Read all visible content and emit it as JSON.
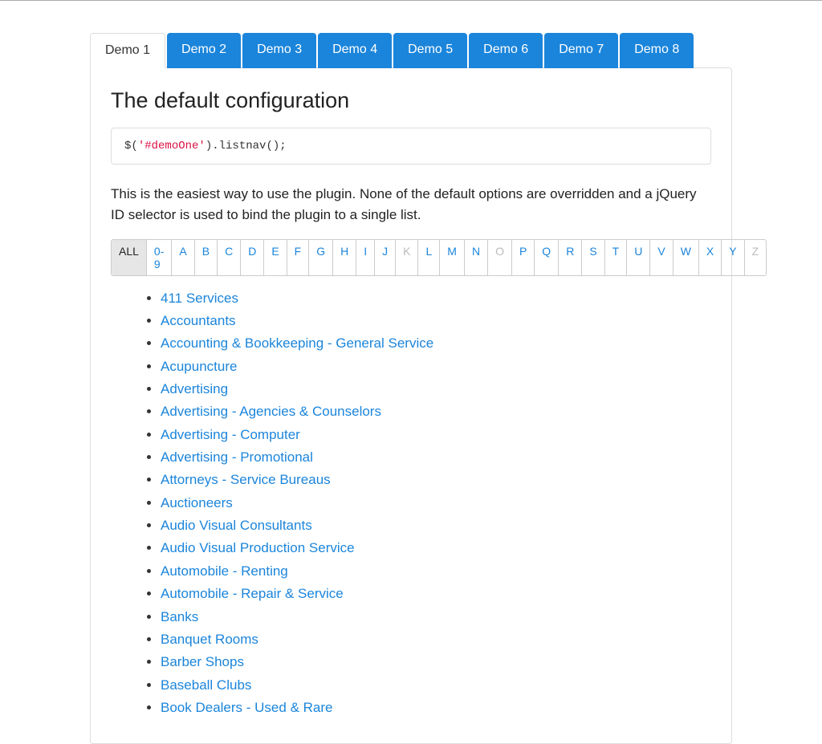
{
  "tabs": [
    {
      "label": "Demo 1",
      "active": true
    },
    {
      "label": "Demo 2",
      "active": false
    },
    {
      "label": "Demo 3",
      "active": false
    },
    {
      "label": "Demo 4",
      "active": false
    },
    {
      "label": "Demo 5",
      "active": false
    },
    {
      "label": "Demo 6",
      "active": false
    },
    {
      "label": "Demo 7",
      "active": false
    },
    {
      "label": "Demo 8",
      "active": false
    }
  ],
  "heading": "The default configuration",
  "code": {
    "prefix": "$(",
    "selector": "'#demoOne'",
    "suffix": ").listnav();"
  },
  "description": "This is the easiest way to use the plugin. None of the default options are overridden and a jQuery ID selector is used to bind the plugin to a single list.",
  "letters": [
    {
      "label": "ALL",
      "state": "selected"
    },
    {
      "label": "0-9",
      "state": "enabled"
    },
    {
      "label": "A",
      "state": "enabled"
    },
    {
      "label": "B",
      "state": "enabled"
    },
    {
      "label": "C",
      "state": "enabled"
    },
    {
      "label": "D",
      "state": "enabled"
    },
    {
      "label": "E",
      "state": "enabled"
    },
    {
      "label": "F",
      "state": "enabled"
    },
    {
      "label": "G",
      "state": "enabled"
    },
    {
      "label": "H",
      "state": "enabled"
    },
    {
      "label": "I",
      "state": "enabled"
    },
    {
      "label": "J",
      "state": "enabled"
    },
    {
      "label": "K",
      "state": "disabled"
    },
    {
      "label": "L",
      "state": "enabled"
    },
    {
      "label": "M",
      "state": "enabled"
    },
    {
      "label": "N",
      "state": "enabled"
    },
    {
      "label": "O",
      "state": "disabled"
    },
    {
      "label": "P",
      "state": "enabled"
    },
    {
      "label": "Q",
      "state": "enabled"
    },
    {
      "label": "R",
      "state": "enabled"
    },
    {
      "label": "S",
      "state": "enabled"
    },
    {
      "label": "T",
      "state": "enabled"
    },
    {
      "label": "U",
      "state": "enabled"
    },
    {
      "label": "V",
      "state": "enabled"
    },
    {
      "label": "W",
      "state": "enabled"
    },
    {
      "label": "X",
      "state": "enabled"
    },
    {
      "label": "Y",
      "state": "enabled"
    },
    {
      "label": "Z",
      "state": "disabled"
    }
  ],
  "items": [
    "411 Services",
    "Accountants",
    "Accounting & Bookkeeping - General Service",
    "Acupuncture",
    "Advertising",
    "Advertising - Agencies & Counselors",
    "Advertising - Computer",
    "Advertising - Promotional",
    "Attorneys - Service Bureaus",
    "Auctioneers",
    "Audio Visual Consultants",
    "Audio Visual Production Service",
    "Automobile - Renting",
    "Automobile - Repair & Service",
    "Banks",
    "Banquet Rooms",
    "Barber Shops",
    "Baseball Clubs",
    "Book Dealers - Used & Rare"
  ]
}
